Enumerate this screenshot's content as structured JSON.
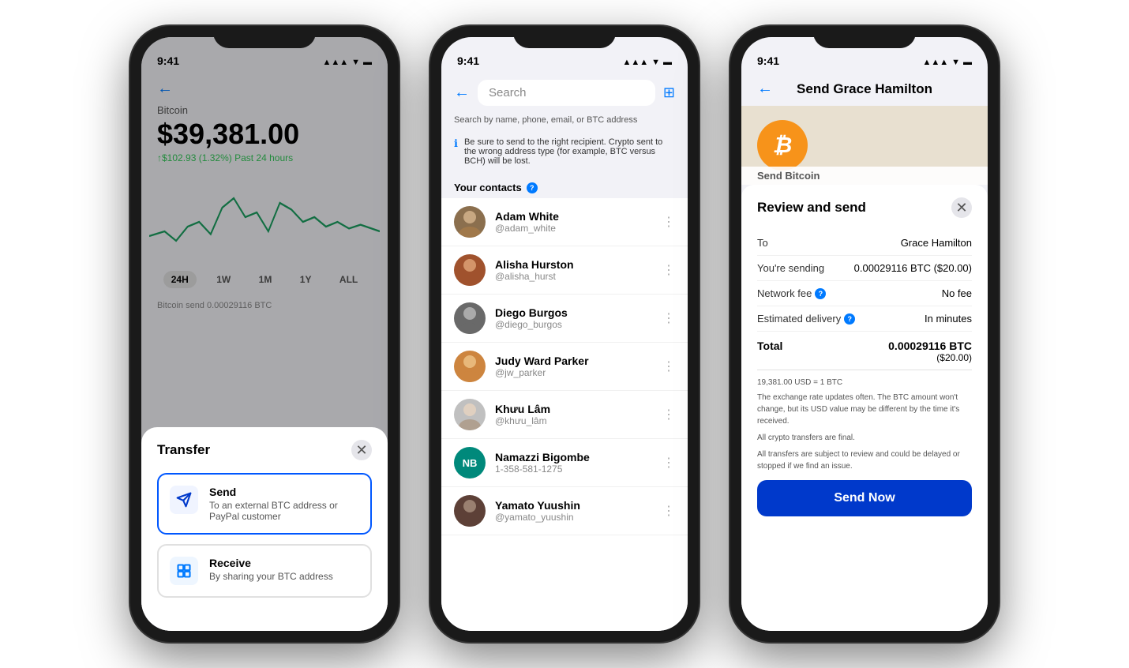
{
  "phone1": {
    "status_time": "9:41",
    "currency_label": "Bitcoin",
    "price": "$39,381.00",
    "change": "↑$102.93 (1.32%) Past 24 hours",
    "filters": [
      "24H",
      "1W",
      "1M",
      "1Y",
      "ALL"
    ],
    "active_filter": "24H",
    "bottom_text": "Bitcoin send    0.00029116 BTC",
    "modal_title": "Transfer",
    "send_title": "Send",
    "send_desc": "To an external BTC address or PayPal customer",
    "receive_title": "Receive",
    "receive_desc": "By sharing your BTC address"
  },
  "phone2": {
    "status_time": "9:41",
    "search_placeholder": "Search",
    "hint": "Search by name, phone, email, or BTC address",
    "warning": "Be sure to send to the right recipient. Crypto sent to the wrong address type (for example, BTC versus BCH) will be lost.",
    "contacts_label": "Your contacts",
    "contacts": [
      {
        "name": "Adam White",
        "handle": "@adam_white",
        "avatar_color": "av-adam",
        "initials": ""
      },
      {
        "name": "Alisha Hurston",
        "handle": "@alisha_hurst",
        "avatar_color": "av-alisha",
        "initials": ""
      },
      {
        "name": "Diego Burgos",
        "handle": "@diego_burgos",
        "avatar_color": "av-diego",
        "initials": ""
      },
      {
        "name": "Judy Ward Parker",
        "handle": "@jw_parker",
        "avatar_color": "av-judy",
        "initials": ""
      },
      {
        "name": "Khưu Lâm",
        "handle": "@khưu_lâm",
        "avatar_color": "av-khuu",
        "initials": ""
      },
      {
        "name": "Namazzi Bigombe",
        "handle": "1-358-581-1275",
        "avatar_color": "av-namazzi",
        "initials": "NB"
      },
      {
        "name": "Yamato Yuushin",
        "handle": "@yamato_yuushin",
        "avatar_color": "av-yamato",
        "initials": ""
      }
    ]
  },
  "phone3": {
    "status_time": "9:41",
    "title": "Send Grace Hamilton",
    "hero_label": "Send Bitcoin",
    "modal_title": "Review and send",
    "to_label": "To",
    "to_value": "Grace Hamilton",
    "sending_label": "You're sending",
    "sending_value": "0.00029116 BTC ($20.00)",
    "fee_label": "Network fee",
    "fee_value": "No fee",
    "delivery_label": "Estimated delivery",
    "delivery_value": "In minutes",
    "total_label": "Total",
    "total_value": "0.00029116 BTC",
    "total_usd": "($20.00)",
    "notes": "19,381.00 USD = 1 BTC\nThe exchange rate updates often. The BTC amount won't change, but its USD value may be different by the time it's received.\n\nAll crypto transfers are final.\n\nAll transfers are subject to review and could be delayed or stopped if we find an issue.",
    "send_now": "Send Now"
  }
}
